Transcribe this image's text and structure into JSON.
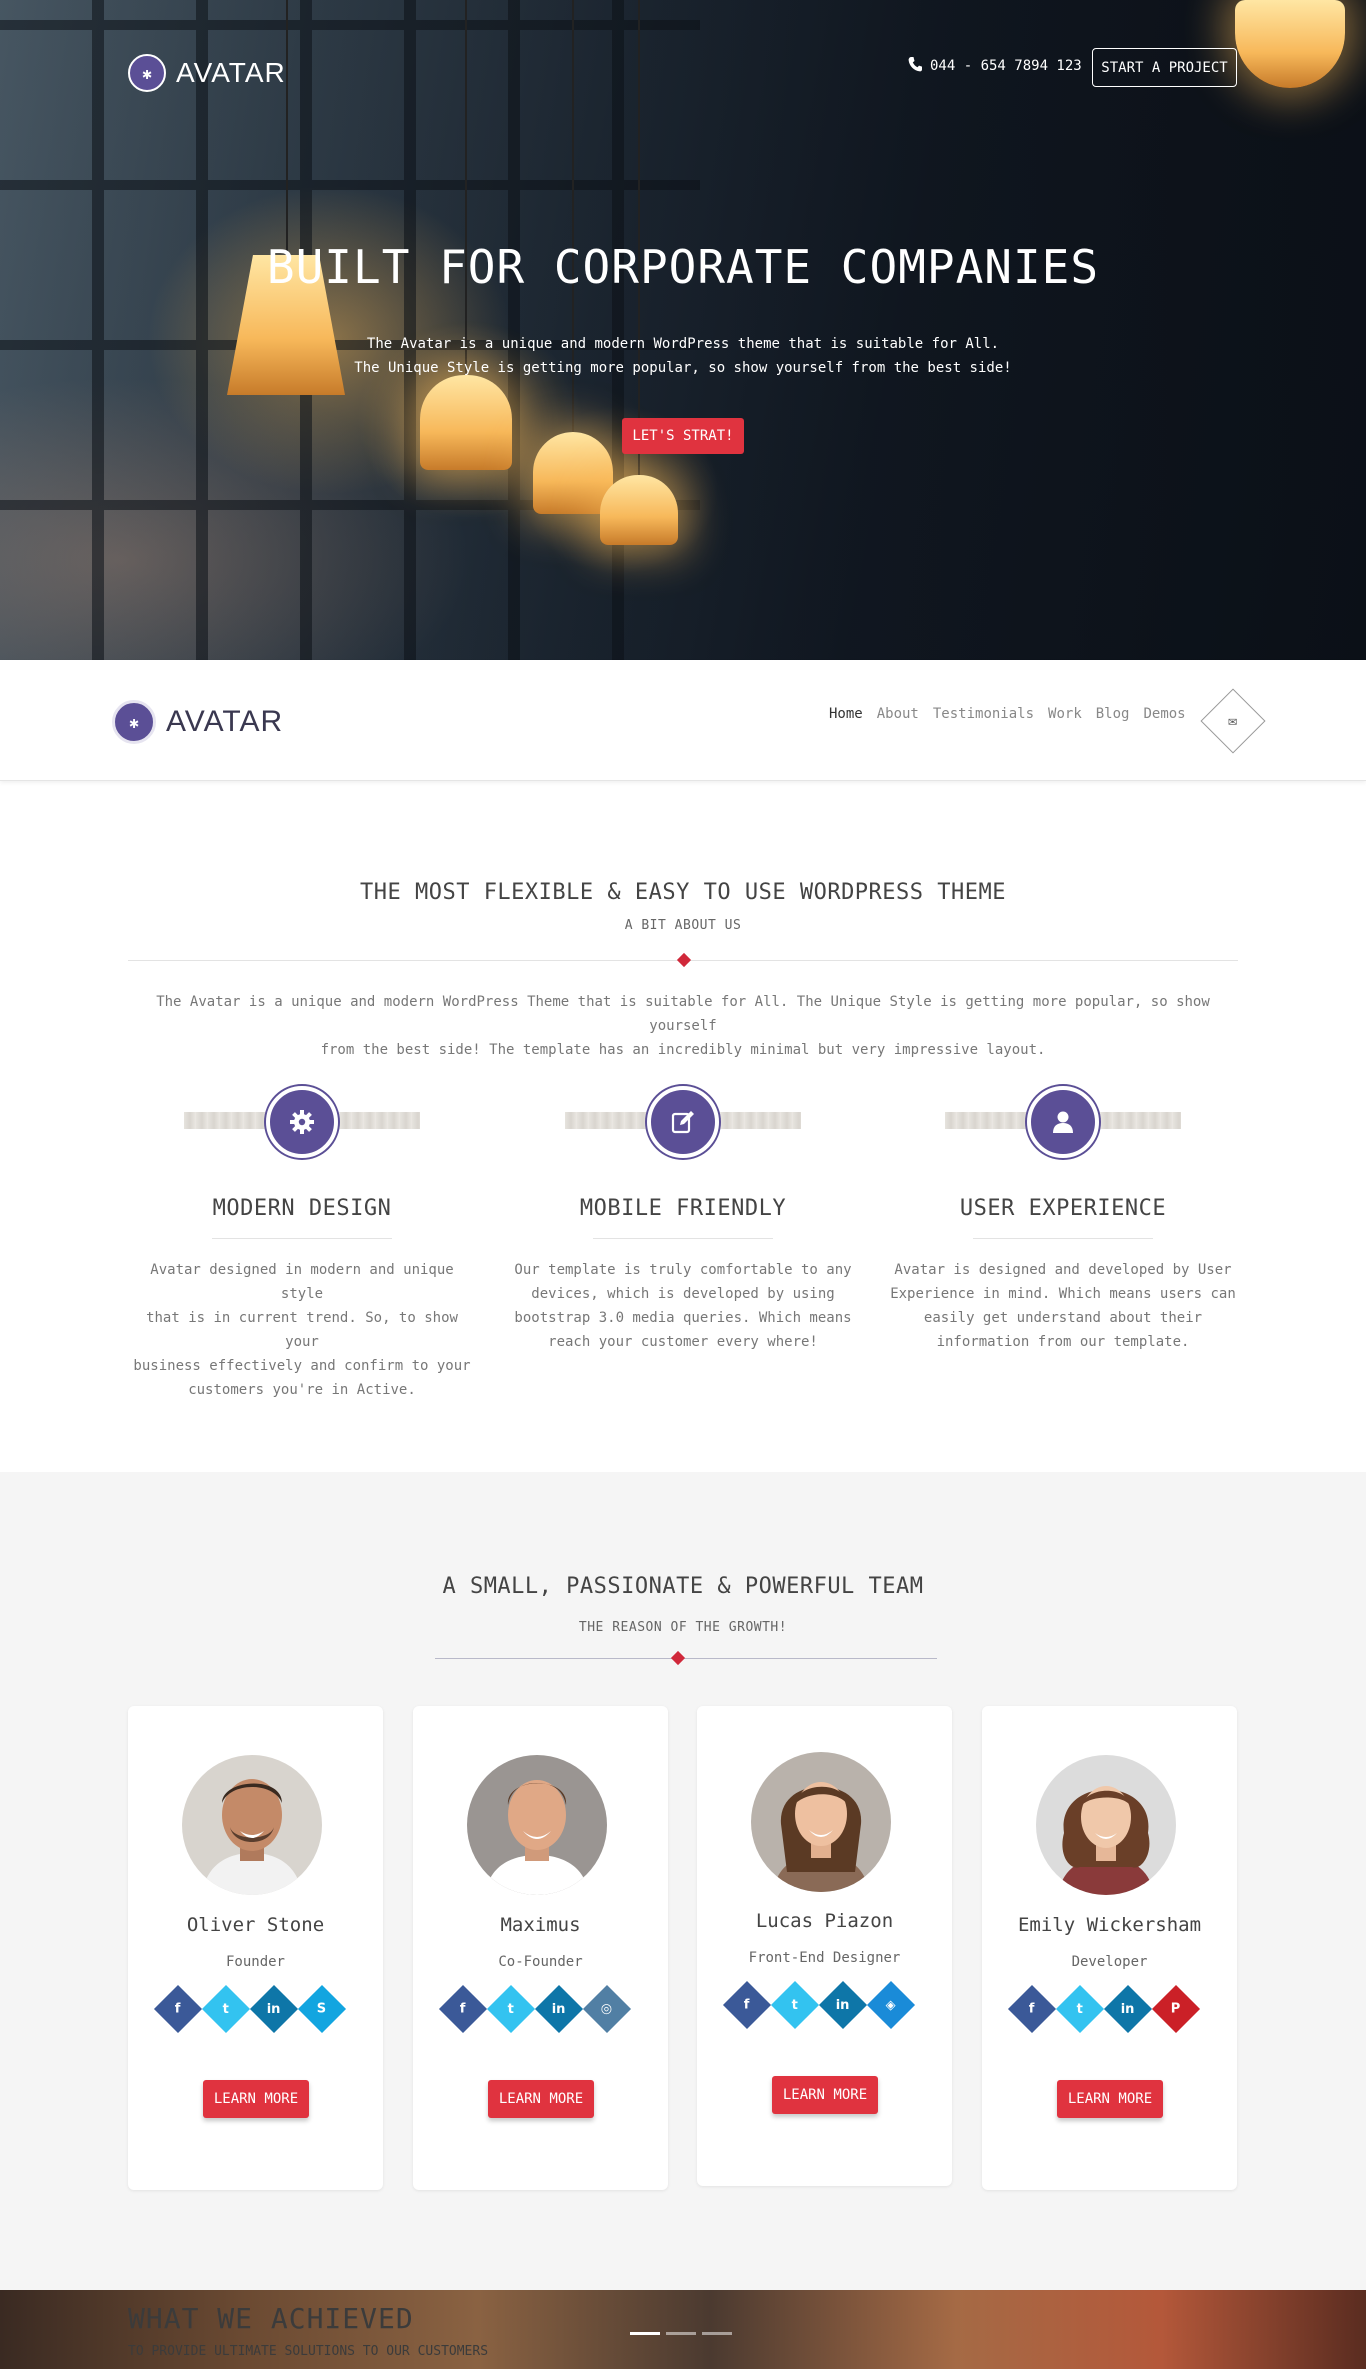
{
  "brand": {
    "name": "AVATAR",
    "accent": "#5b4f96",
    "red": "#e0333f"
  },
  "hero": {
    "phone": "044 - 654 7894 123",
    "cta": "START A PROJECT",
    "title": "BUILT FOR CORPORATE COMPANIES",
    "subtitle_line1": "The Avatar is a unique and modern WordPress theme that is suitable for All.",
    "subtitle_line2": "The Unique Style is getting more popular, so show yourself from the best side!",
    "button": "LET'S STRAT!"
  },
  "nav": {
    "items": [
      {
        "label": "Home",
        "active": true
      },
      {
        "label": "About"
      },
      {
        "label": "Testimonials"
      },
      {
        "label": "Work"
      },
      {
        "label": "Blog"
      },
      {
        "label": "Demos"
      }
    ],
    "mail_icon": "envelope-icon"
  },
  "about": {
    "title": "THE MOST FLEXIBLE & EASY TO USE WORDPRESS THEME",
    "subtitle": "A BIT ABOUT US",
    "text_line1": "The Avatar is a unique and modern WordPress Theme that is suitable for All. The Unique Style is getting more popular, so show yourself",
    "text_line2": "from the best side! The template has an incredibly minimal but very impressive layout.",
    "features": [
      {
        "icon": "gear-icon",
        "title": "MODERN DESIGN",
        "lines": [
          "Avatar designed in modern and unique style",
          "that is in current trend. So, to show your",
          "business effectively and confirm to your",
          "customers you're in Active."
        ]
      },
      {
        "icon": "edit-icon",
        "title": "MOBILE FRIENDLY",
        "lines": [
          "Our template is truly comfortable to any",
          "devices, which is developed by using",
          "bootstrap 3.0 media queries. Which means",
          "reach your customer every where!"
        ]
      },
      {
        "icon": "user-icon",
        "title": "USER EXPERIENCE",
        "lines": [
          "Avatar is designed and developed by User",
          "Experience in mind. Which means users can",
          "easily get understand about their",
          "information from our template."
        ]
      }
    ]
  },
  "team": {
    "title": "A SMALL, PASSIONATE & POWERFUL TEAM",
    "subtitle": "THE REASON OF THE GROWTH!",
    "members": [
      {
        "name": "Oliver Stone",
        "role": "Founder",
        "socials": [
          "facebook",
          "twitter",
          "linkedin",
          "skype"
        ],
        "button": "LEARN MORE"
      },
      {
        "name": "Maximus",
        "role": "Co-Founder",
        "socials": [
          "facebook",
          "twitter",
          "linkedin",
          "instagram"
        ],
        "button": "LEARN MORE"
      },
      {
        "name": "Lucas Piazon",
        "role": "Front-End Designer",
        "socials": [
          "facebook",
          "twitter",
          "linkedin",
          "dropbox"
        ],
        "button": "LEARN MORE"
      },
      {
        "name": "Emily Wickersham",
        "role": "Developer",
        "socials": [
          "facebook",
          "twitter",
          "linkedin",
          "pinterest"
        ],
        "button": "LEARN MORE"
      }
    ],
    "social_colors": {
      "facebook": "#3b5998",
      "twitter": "#33c3f0",
      "linkedin": "#0e76a8",
      "skype": "#12a5e0",
      "instagram": "#517fa4",
      "dropbox": "#1a8bd8",
      "pinterest": "#cb2027"
    },
    "social_glyphs": {
      "facebook": "f",
      "twitter": "t",
      "linkedin": "in",
      "skype": "S",
      "instagram": "◎",
      "dropbox": "◈",
      "pinterest": "P"
    }
  },
  "achieved": {
    "title": "WHAT WE ACHIEVED",
    "subtitle": "TO PROVIDE ULTIMATE SOLUTIONS TO OUR CUSTOMERS"
  }
}
